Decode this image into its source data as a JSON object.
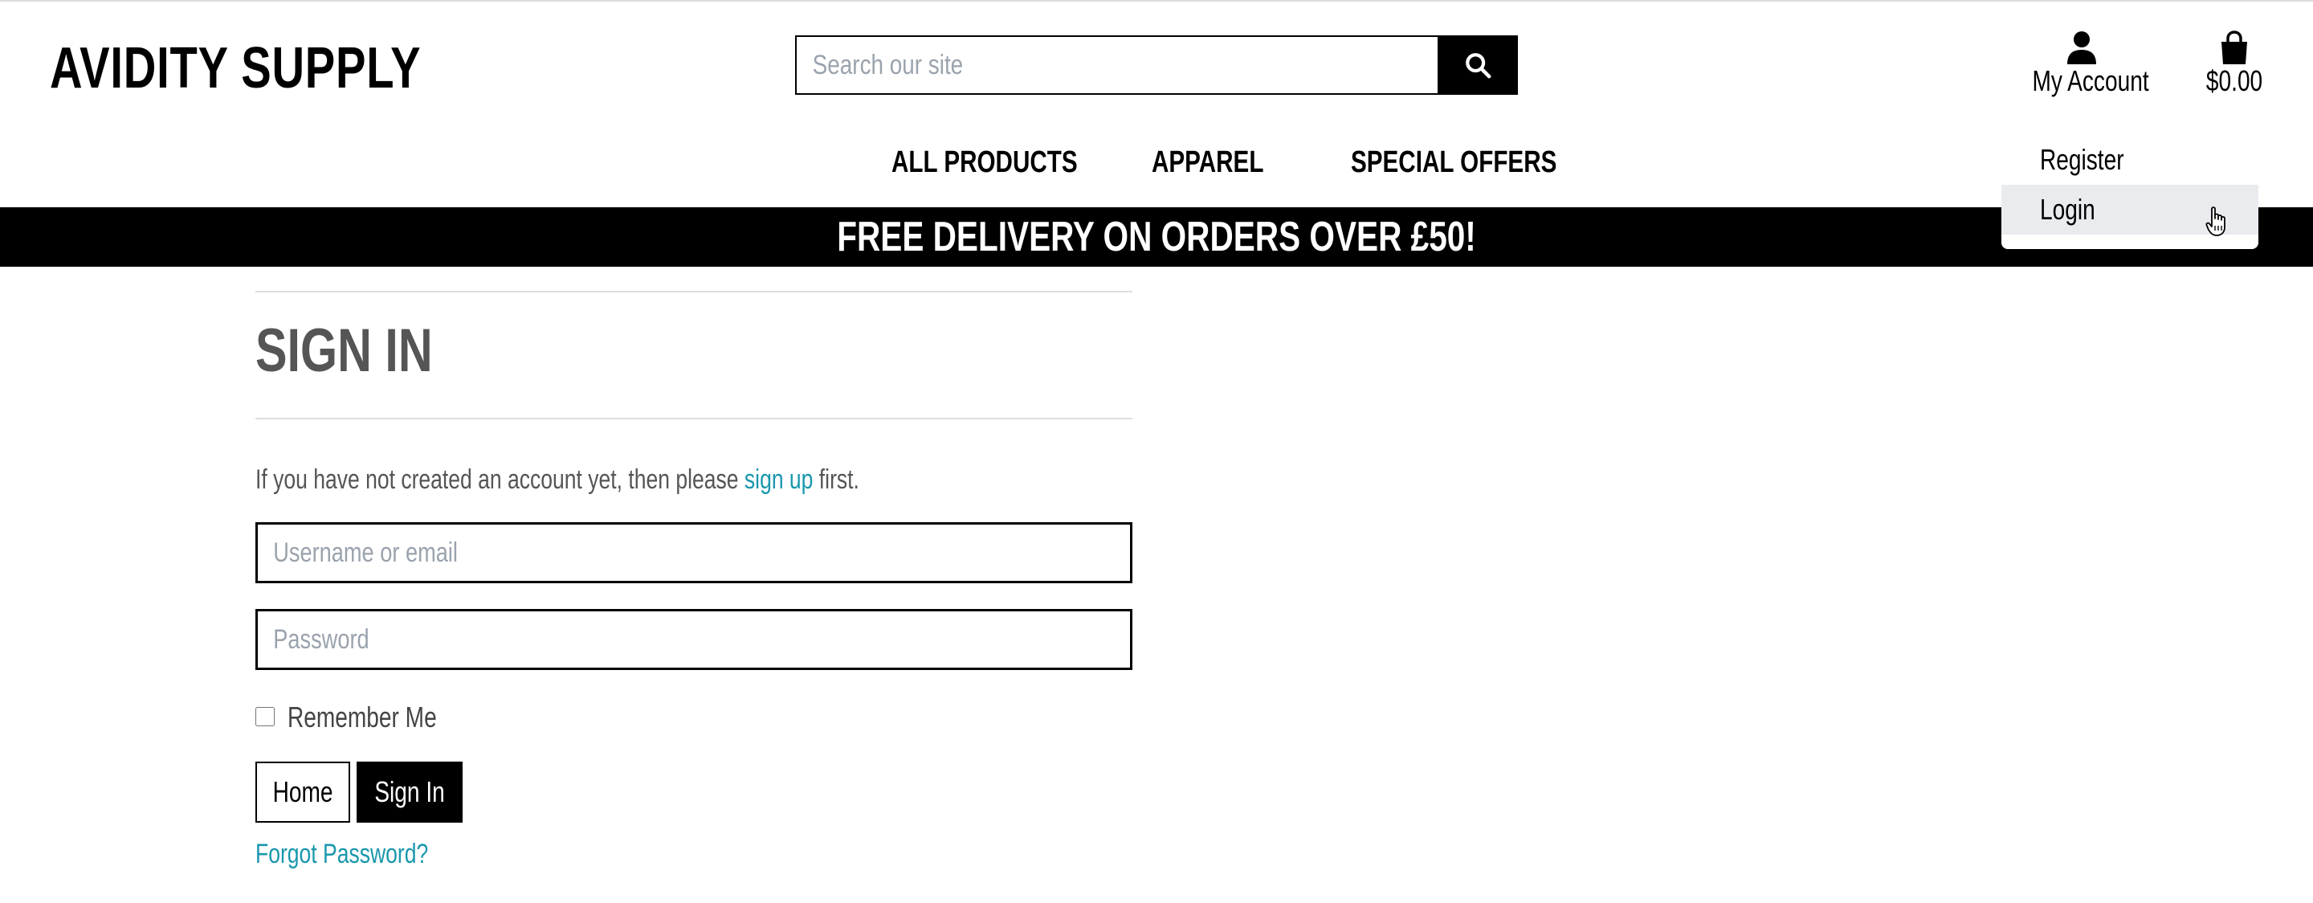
{
  "header": {
    "logo": "AVIDITY SUPPLY",
    "search_placeholder": "Search our site",
    "account_label": "My Account",
    "cart_total": "$0.00"
  },
  "nav": {
    "items": [
      {
        "label": "ALL PRODUCTS"
      },
      {
        "label": "APPAREL"
      },
      {
        "label": "SPECIAL OFFERS"
      }
    ]
  },
  "account_menu": {
    "items": [
      {
        "label": "Register"
      },
      {
        "label": "Login"
      }
    ]
  },
  "banner": {
    "text": "FREE DELIVERY ON ORDERS OVER £50!"
  },
  "signin": {
    "title": "SIGN IN",
    "intro_before": "If you have not created an account yet, then please",
    "intro_link": "sign up",
    "intro_after": "first.",
    "username_placeholder": "Username or email",
    "password_placeholder": "Password",
    "remember_label": "Remember Me",
    "home_button": "Home",
    "signin_button": "Sign In",
    "forgot_link": "Forgot Password?"
  },
  "colors": {
    "link": "#1a97ad",
    "banner_bg": "#000000",
    "menu_hover": "#e9ebef",
    "placeholder": "#9aa3ad"
  },
  "icons": {
    "search": "search-icon",
    "account": "user-icon",
    "cart": "shopping-bag-icon",
    "cursor": "hand-pointer-icon"
  }
}
